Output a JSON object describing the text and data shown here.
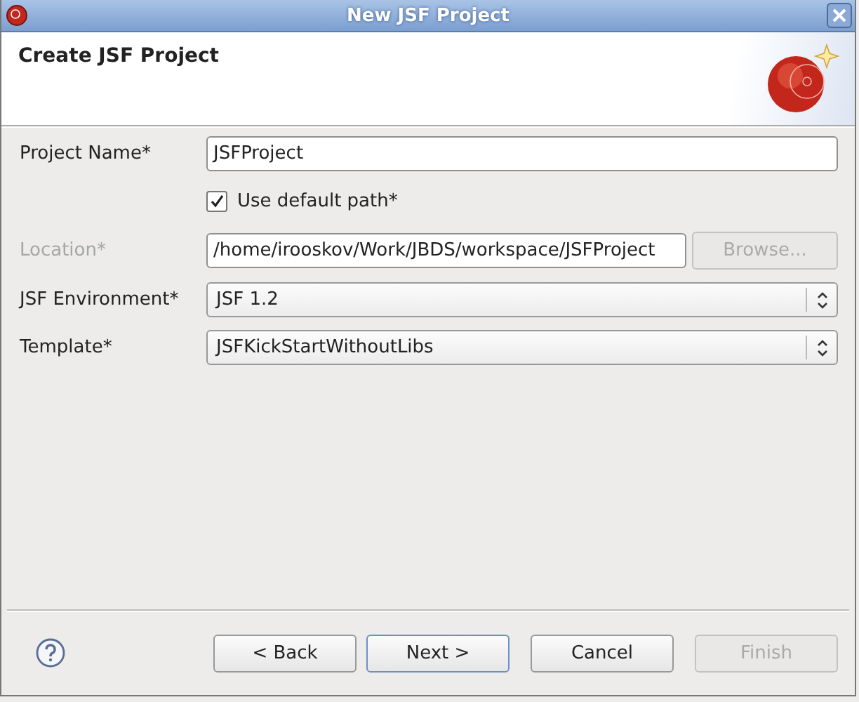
{
  "window": {
    "title": "New JSF Project"
  },
  "header": {
    "title": "Create JSF Project"
  },
  "fields": [
    {
      "kind": "text",
      "label": "Project Name*",
      "value": "JSFProject",
      "disabled": false
    },
    {
      "kind": "checkbox",
      "label": "Use default path*",
      "checked": true
    },
    {
      "kind": "path",
      "label": "Location*",
      "value": "/home/irooskov/Work/JBDS/workspace/JSFProject",
      "disabled": true,
      "button": "Browse..."
    },
    {
      "kind": "select",
      "label": "JSF Environment*",
      "value": "JSF 1.2",
      "disabled": false
    },
    {
      "kind": "select",
      "label": "Template*",
      "value": "JSFKickStartWithoutLibs",
      "disabled": false
    }
  ],
  "buttons": [
    {
      "label": "< Back",
      "disabled": false,
      "focused": false
    },
    {
      "label": "Next >",
      "disabled": false,
      "focused": true
    },
    {
      "label": "Cancel",
      "disabled": false,
      "focused": false
    },
    {
      "label": "Finish",
      "disabled": true,
      "focused": false
    }
  ]
}
